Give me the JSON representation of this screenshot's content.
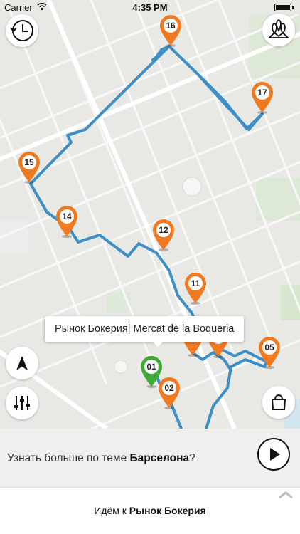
{
  "status_bar": {
    "carrier": "Carrier",
    "time": "4:35 PM",
    "battery_level": 1.0
  },
  "map": {
    "route_color": "#3d8fc6",
    "markers": [
      {
        "label": "16",
        "color": "#f07a22"
      },
      {
        "label": "17",
        "color": "#f07a22"
      },
      {
        "label": "15",
        "color": "#f07a22"
      },
      {
        "label": "14",
        "color": "#f07a22"
      },
      {
        "label": "12",
        "color": "#f07a22"
      },
      {
        "label": "11",
        "color": "#f07a22"
      },
      {
        "label": "",
        "color": "#f07a22"
      },
      {
        "label": "",
        "color": "#f07a22"
      },
      {
        "label": "05",
        "color": "#f07a22"
      },
      {
        "label": "01",
        "color": "#3faa35"
      },
      {
        "label": "02",
        "color": "#f07a22"
      }
    ],
    "callout": "Рынок Бокерия| Mercat de la Boqueria"
  },
  "buttons": {
    "history_icon": "clock-history-icon",
    "places_icon": "map-pins-icon",
    "locate_icon": "navigation-arrow-icon",
    "filter_icon": "sliders-icon",
    "shop_icon": "shopping-bag-icon"
  },
  "info": {
    "prefix": "Узнать больше по теме ",
    "topic": "Барселона",
    "suffix": "?",
    "play_icon": "play-icon"
  },
  "nav": {
    "prefix": "Идём к ",
    "destination": "Рынок Бокерия",
    "chevron_icon": "chevron-up-icon"
  }
}
